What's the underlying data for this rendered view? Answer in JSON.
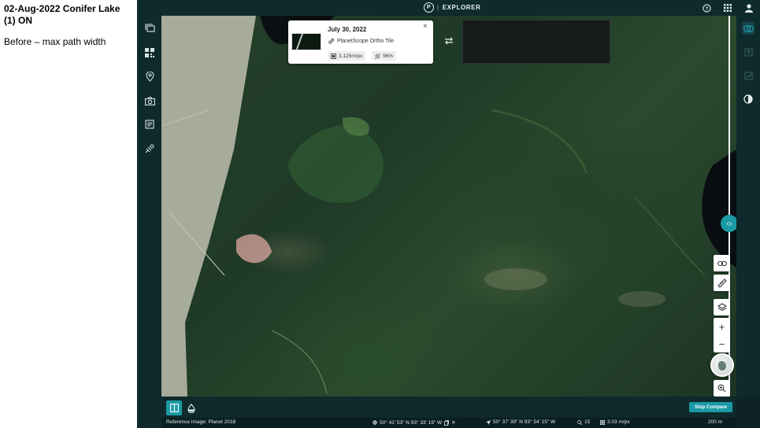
{
  "note": {
    "title": "02-Aug-2022 Conifer Lake (1) ON",
    "subtitle": "Before – max path width"
  },
  "topbar": {
    "logo_letter": "P",
    "separator": "|",
    "app_name": "EXPLORER",
    "icons": [
      "help-icon",
      "apps-grid-icon",
      "user-icon"
    ]
  },
  "left_rail": {
    "icons": [
      "imagery-stack-icon",
      "qr-grid-icon",
      "location-pin-icon",
      "camera-icon",
      "tasks-icon",
      "satellite-icon",
      "settings-gear-icon"
    ]
  },
  "right_rail": {
    "icons": [
      "compare-circles-icon",
      "export-icon",
      "chart-icon",
      "contrast-icon"
    ]
  },
  "popup": {
    "date": "July 30, 2022",
    "close": "×",
    "product": "PlanetScope Ortho Tile",
    "resolution": "3.125m/px",
    "coverage": "96%"
  },
  "map_controls": {
    "link_icon": "link-icon",
    "ruler_icon": "ruler-icon",
    "layers_icon": "layers-icon",
    "zoom_in": "+",
    "zoom_out": "−",
    "zoom_extent_icon": "zoom-icon",
    "split_handle": "‹›"
  },
  "bottom_bar": {
    "stop_compare": "Stop Compare"
  },
  "status_bar": {
    "reference": "Reference Image: Planet 2018",
    "cursor_coords": "50° 41' 53\" N 93° 33' 19\" W",
    "nav_coords": "50° 37' 39\" N 93° 54' 15\" W",
    "zoom": "15",
    "resolution": "3.03 m/px",
    "scale": "200 m"
  },
  "colors": {
    "accent": "#1a9aa6",
    "panel": "#0e2a2c",
    "map_forest": "#243f29"
  }
}
